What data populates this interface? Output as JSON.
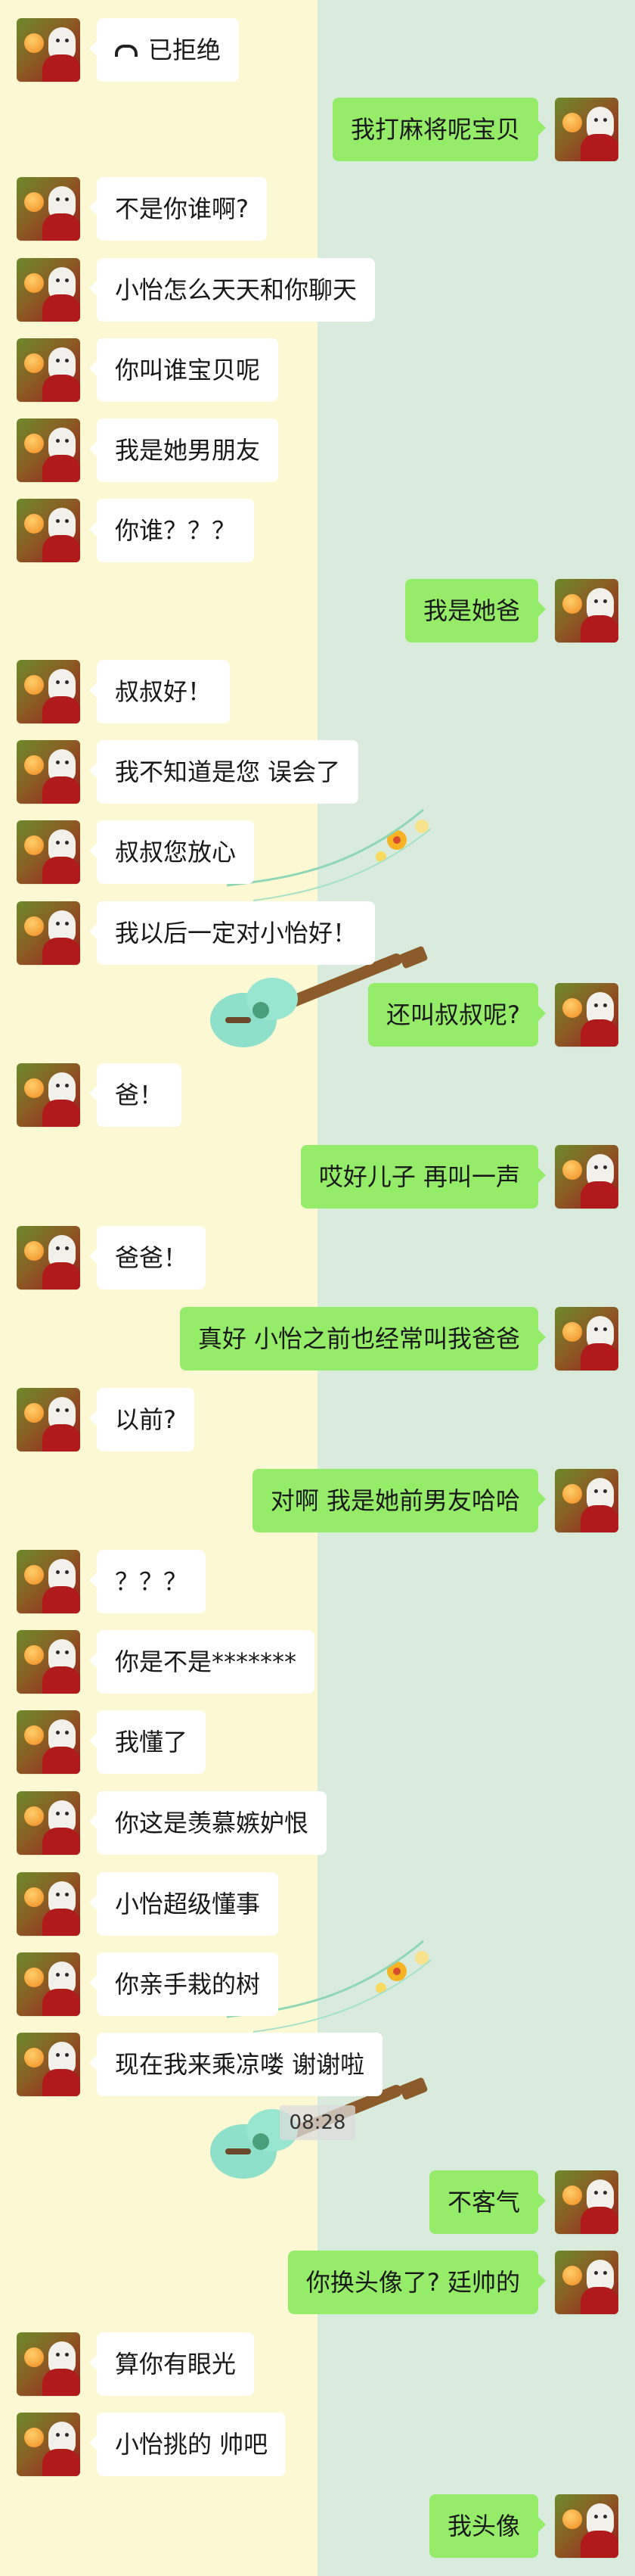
{
  "screen": {
    "title": "WeChat chat screenshot",
    "left_background": "#fbf8d3",
    "right_background": "#d9ebdd",
    "incoming_bubble_color": "#ffffff",
    "outgoing_bubble_color": "#95ec69"
  },
  "timestamp": "08:28",
  "messages": [
    {
      "side": "left",
      "text": "已拒绝",
      "icon": "phone-icon"
    },
    {
      "side": "right",
      "text": "我打麻将呢宝贝"
    },
    {
      "side": "left",
      "text": "不是你谁啊?"
    },
    {
      "side": "left",
      "text": "小怡怎么天天和你聊天"
    },
    {
      "side": "left",
      "text": "你叫谁宝贝呢"
    },
    {
      "side": "left",
      "text": "我是她男朋友"
    },
    {
      "side": "left",
      "text": "你谁？？？"
    },
    {
      "side": "right",
      "text": "我是她爸"
    },
    {
      "side": "left",
      "text": "叔叔好！"
    },
    {
      "side": "left",
      "text": "我不知道是您  误会了"
    },
    {
      "side": "left",
      "text": "叔叔您放心"
    },
    {
      "side": "left",
      "text": "我以后一定对小怡好！"
    },
    {
      "side": "right",
      "text": "还叫叔叔呢?"
    },
    {
      "side": "left",
      "text": "爸！"
    },
    {
      "side": "right",
      "text": "哎好儿子  再叫一声"
    },
    {
      "side": "left",
      "text": "爸爸！"
    },
    {
      "side": "right",
      "text": "真好  小怡之前也经常叫我爸爸"
    },
    {
      "side": "left",
      "text": "以前?"
    },
    {
      "side": "right",
      "text": "对啊  我是她前男友哈哈"
    },
    {
      "side": "left",
      "text": "？？？"
    },
    {
      "side": "left",
      "text": "你是不是*******"
    },
    {
      "side": "left",
      "text": "我懂了"
    },
    {
      "side": "left",
      "text": "你这是羡慕嫉妒恨"
    },
    {
      "side": "left",
      "text": "小怡超级懂事"
    },
    {
      "side": "left",
      "text": "你亲手栽的树"
    },
    {
      "side": "left",
      "text": "现在我来乘凉喽  谢谢啦"
    },
    {
      "side": "right",
      "text": "不客气"
    },
    {
      "side": "right",
      "text": "你换头像了?   廷帅的"
    },
    {
      "side": "left",
      "text": "算你有眼光"
    },
    {
      "side": "left",
      "text": "小怡挑的  帅吧"
    },
    {
      "side": "right",
      "text": "我头像"
    }
  ]
}
